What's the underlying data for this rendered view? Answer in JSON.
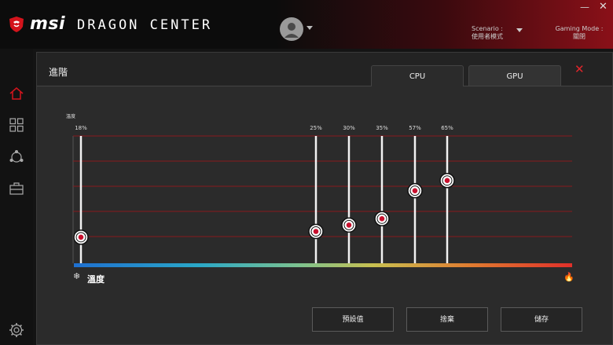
{
  "header": {
    "brand": "msi",
    "app_title": "DRAGON CENTER",
    "scenario_label": "Scenario :",
    "scenario_value": "使用者模式",
    "gaming_mode_label": "Gaming Mode :",
    "gaming_mode_value": "關閉",
    "minimize": "—",
    "close": "✕"
  },
  "sidebar": {
    "items": [
      {
        "icon": "home-icon"
      },
      {
        "icon": "grid-icon"
      },
      {
        "icon": "network-icon"
      },
      {
        "icon": "toolbox-icon"
      },
      {
        "icon": "gear-icon"
      }
    ]
  },
  "panel": {
    "title": "進階",
    "tabs": [
      {
        "label": "CPU",
        "active": true
      },
      {
        "label": "GPU",
        "active": false
      }
    ],
    "close": "✕",
    "temp_axis_label": "溫度",
    "gradient_label": "溫度",
    "buttons": {
      "default": "預設值",
      "discard": "捨棄",
      "save": "儲存"
    }
  },
  "colors": {
    "accent_red": "#c8102e",
    "gridline": "#8a1a1e"
  },
  "chart_data": {
    "type": "line",
    "title": "",
    "xlabel": "溫度",
    "ylabel": "溫度",
    "points": [
      {
        "label": "18%",
        "value": 18
      },
      {
        "label": "25%",
        "value": 25
      },
      {
        "label": "30%",
        "value": 30
      },
      {
        "label": "35%",
        "value": 35
      },
      {
        "label": "57%",
        "value": 57
      },
      {
        "label": "65%",
        "value": 65
      }
    ],
    "grid": true
  }
}
